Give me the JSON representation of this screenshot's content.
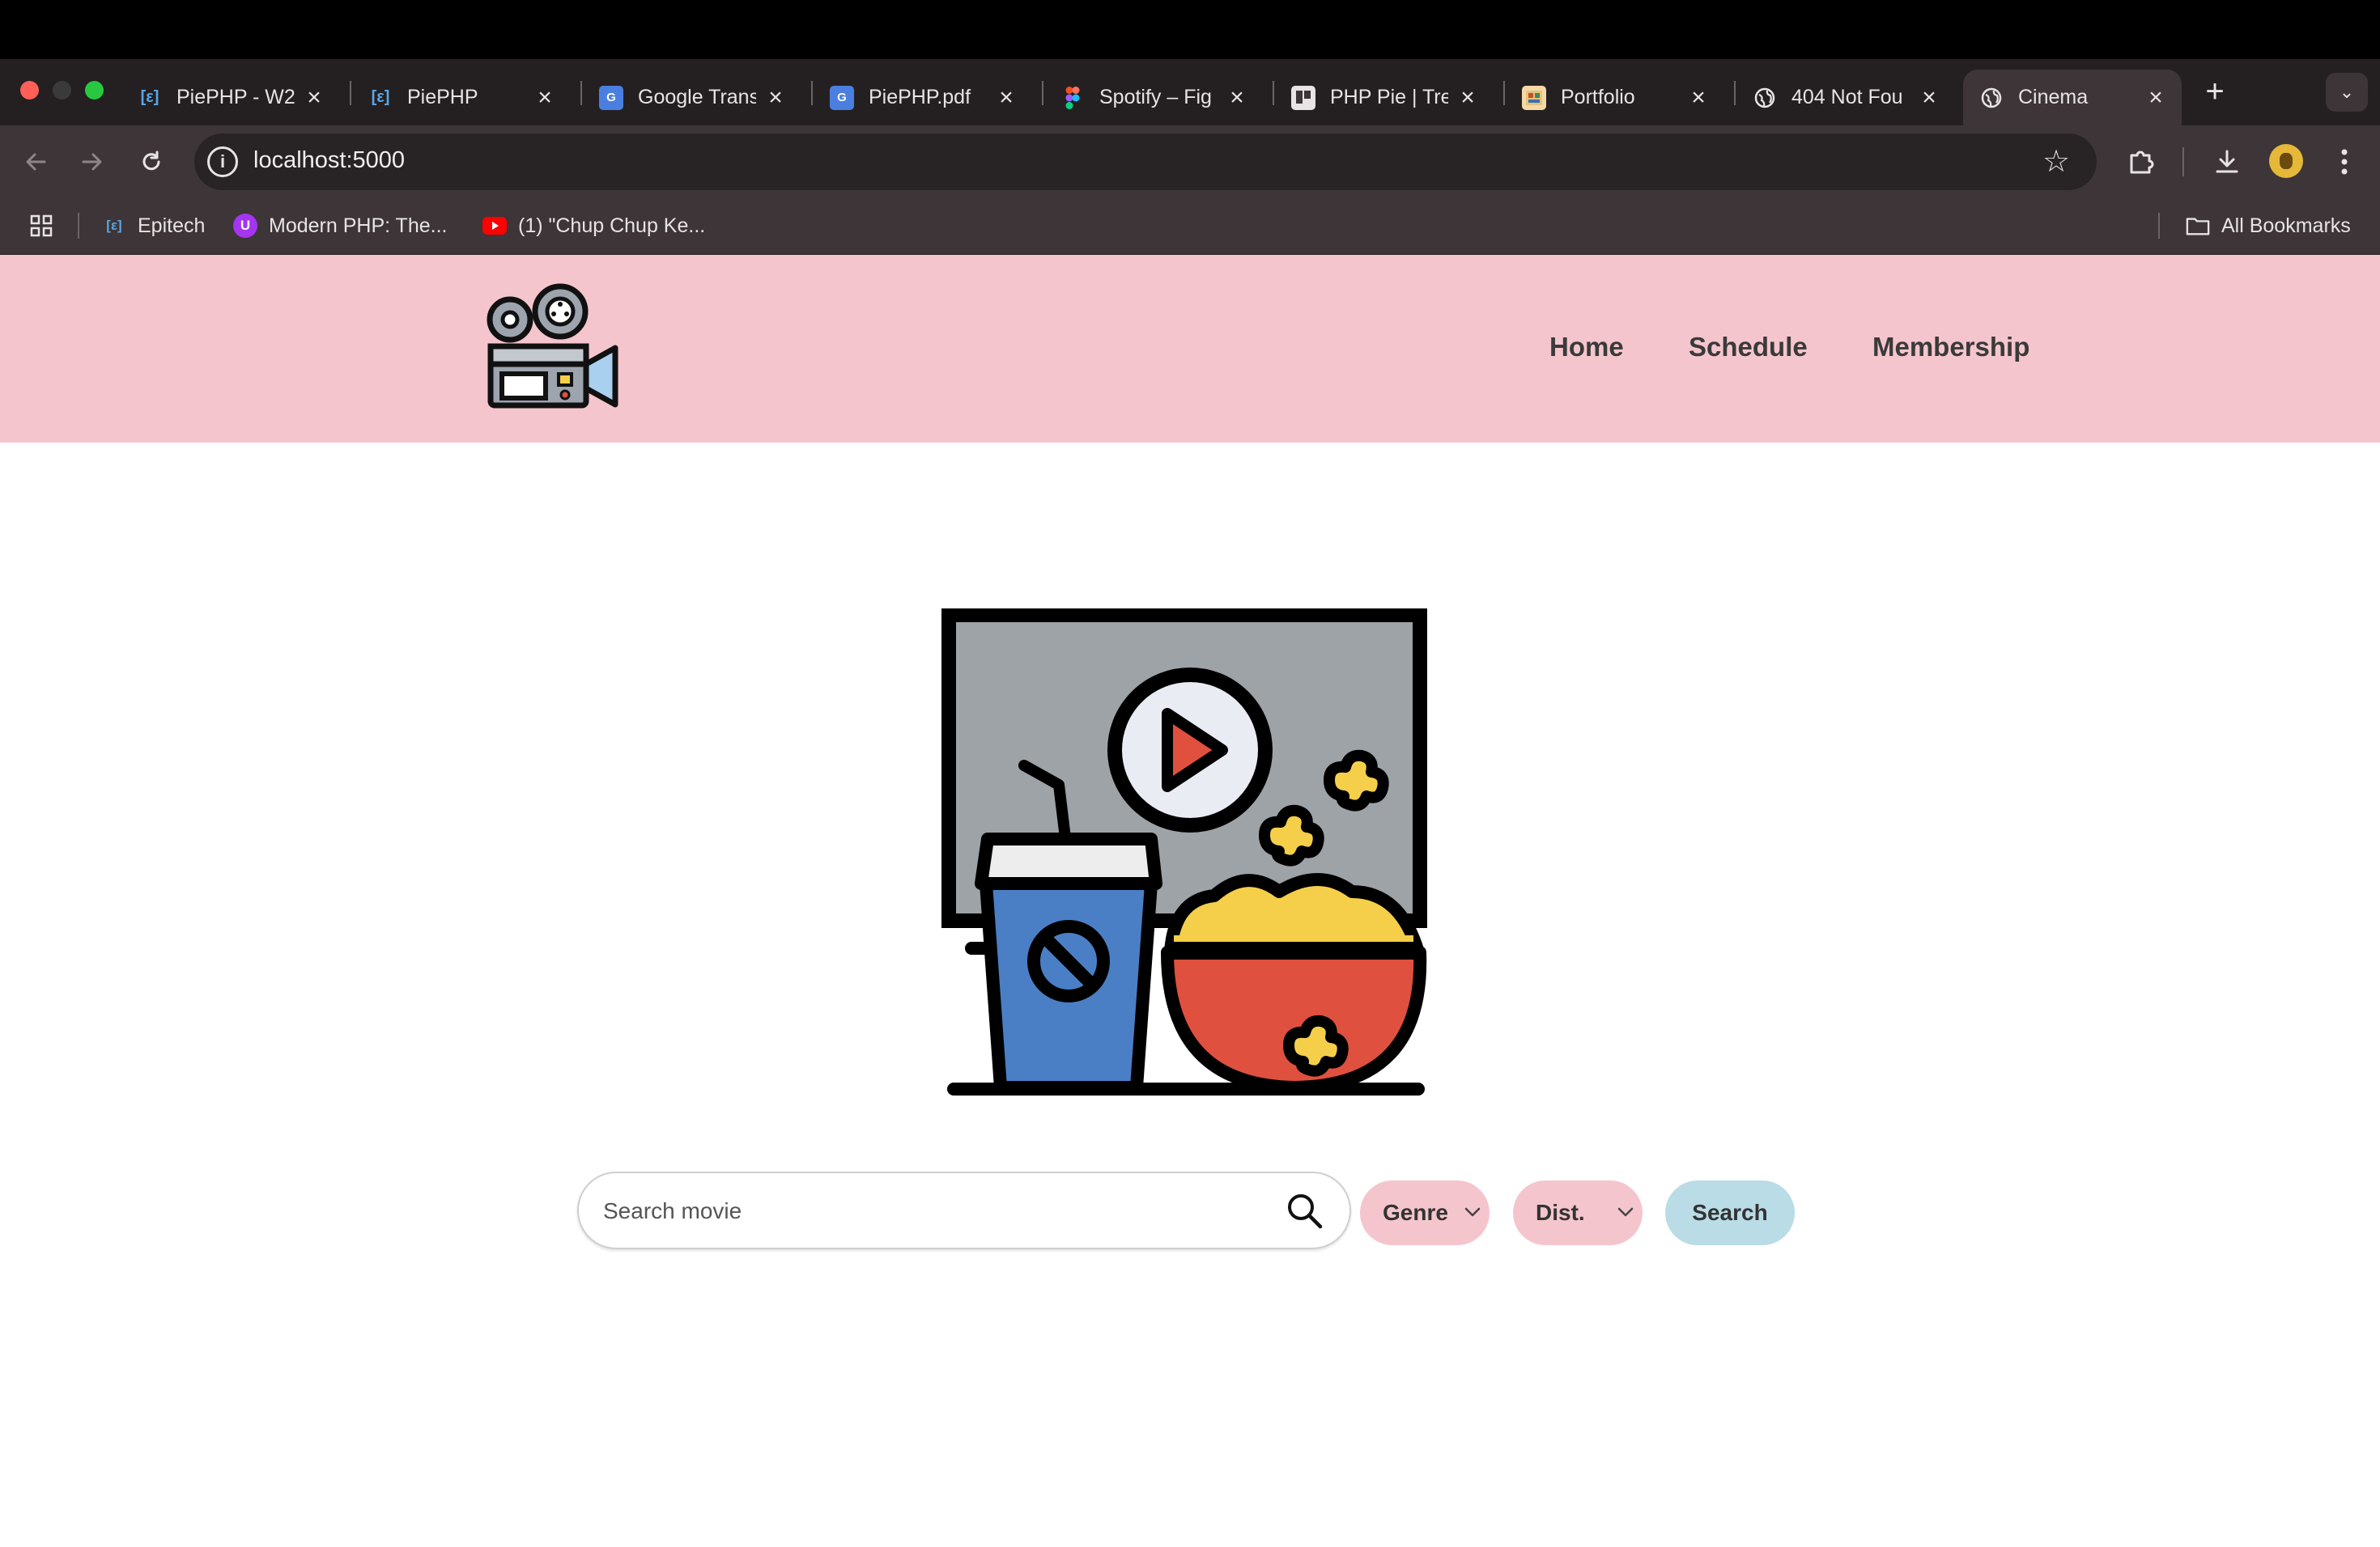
{
  "browser": {
    "tabs": [
      {
        "title": "PiePHP - W2",
        "favicon": "epitech-icon",
        "active": false
      },
      {
        "title": "PiePHP",
        "favicon": "epitech-icon",
        "active": false
      },
      {
        "title": "Google Trans",
        "favicon": "google-translate-icon",
        "active": false
      },
      {
        "title": "PiePHP.pdf",
        "favicon": "google-translate-icon",
        "active": false
      },
      {
        "title": "Spotify – Fig",
        "favicon": "figma-icon",
        "active": false
      },
      {
        "title": "PHP Pie | Tre",
        "favicon": "trello-icon",
        "active": false
      },
      {
        "title": "Portfolio",
        "favicon": "portfolio-icon",
        "active": false
      },
      {
        "title": "404 Not Fou",
        "favicon": "globe-icon",
        "active": false
      },
      {
        "title": "Cinema",
        "favicon": "globe-icon",
        "active": true
      }
    ],
    "new_tab": "+",
    "url": "localhost:5000",
    "bookmarks": [
      {
        "label": "Epitech",
        "icon": "epitech-icon"
      },
      {
        "label": "Modern PHP: The...",
        "icon": "udemy-icon"
      },
      {
        "label": "(1) \"Chup Chup Ke...",
        "icon": "youtube-icon"
      }
    ],
    "all_bookmarks": "All Bookmarks"
  },
  "site": {
    "nav": {
      "home": "Home",
      "schedule": "Schedule",
      "membership": "Membership"
    },
    "search": {
      "placeholder": "Search movie",
      "genre_label": "Genre",
      "dist_label": "Dist.",
      "button_label": "Search"
    }
  },
  "colors": {
    "header_bg": "#f5c5cd",
    "pill_pink": "#f5c5cd",
    "search_button": "#b9dce7"
  }
}
